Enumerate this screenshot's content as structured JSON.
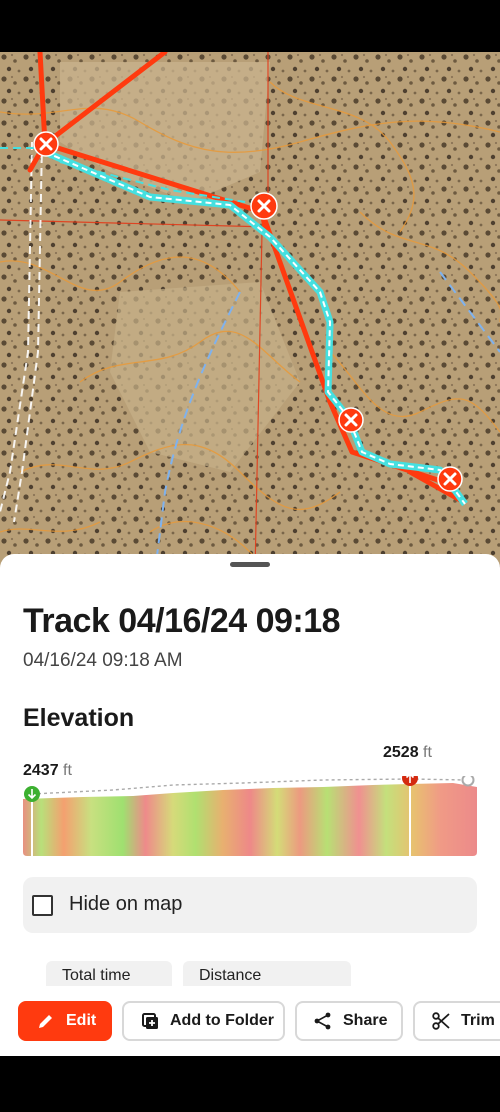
{
  "track": {
    "title": "Track 04/16/24 09:18",
    "subtitle": "04/16/24 09:18 AM"
  },
  "elevation": {
    "heading": "Elevation",
    "min_value": "2437",
    "max_value": "2528",
    "unit": "ft"
  },
  "hide_on_map": {
    "label": "Hide on map",
    "checked": false
  },
  "stats": {
    "tabs": [
      "Total time",
      "Distance"
    ]
  },
  "actions": {
    "edit": "Edit",
    "add_to_folder": "Add to Folder",
    "share": "Share",
    "trim": "Trim"
  },
  "colors": {
    "accent": "#ff3a0f",
    "track_line": "#45e0e0",
    "route_line": "#ff3a0f",
    "start_marker": "#3cb030",
    "end_marker": "#d42a10"
  },
  "icons": {
    "edit": "pencil-icon",
    "add_to_folder": "folder-plus-icon",
    "share": "share-icon",
    "trim": "scissors-icon"
  }
}
